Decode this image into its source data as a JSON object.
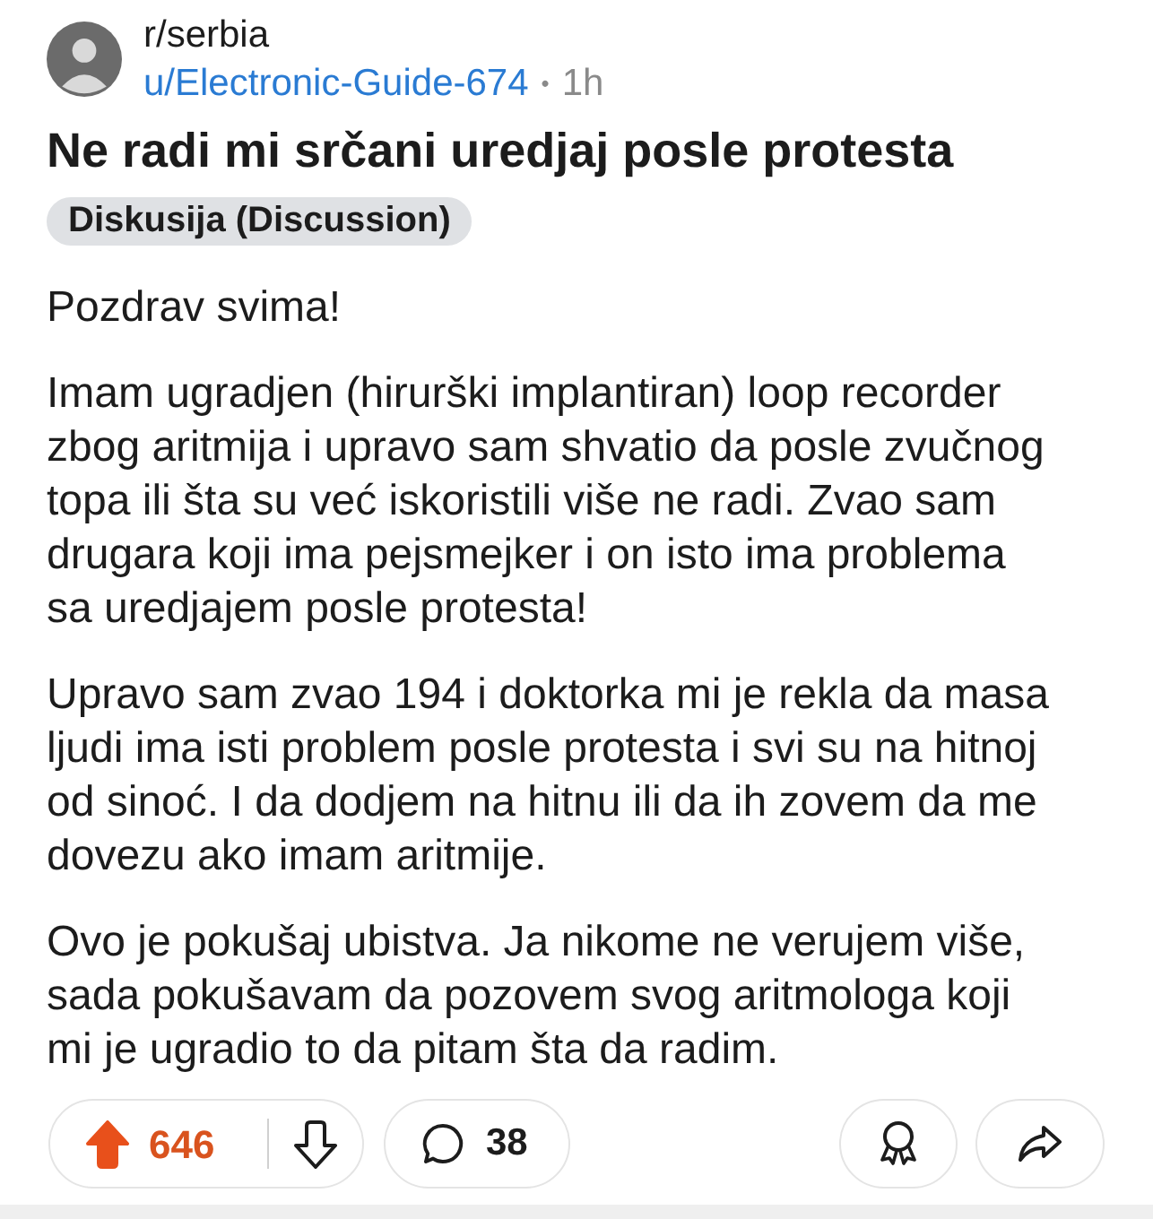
{
  "post": {
    "subreddit": "r/serbia",
    "author": "u/Electronic-Guide-674",
    "separator": "•",
    "age": "1h",
    "title": "Ne radi mi srčani uredjaj posle protesta",
    "flair": "Diskusija (Discussion)",
    "body": [
      "Pozdrav svima!",
      "Imam ugradjen (hirurški implantiran) loop recorder zbog aritmija i upravo sam shvatio da posle zvučnog topa ili šta su već iskoristili više ne radi. Zvao sam drugara koji ima pejsmejker i on isto ima problema sa uredjajem posle protesta!",
      "Upravo sam zvao 194 i doktorka mi je rekla da masa ljudi ima isti problem posle protesta i svi su na hitnoj od sinoć. I da dodjem na hitnu ili da ih zovem da me dovezu ako imam aritmije.",
      "Ovo je pokušaj ubistva. Ja nikome ne verujem više, sada pokušavam da pozovem svog aritmologa koji mi je ugradio to da pitam šta da radim."
    ]
  },
  "actions": {
    "upvoted": true,
    "score": "646",
    "comments": "38"
  }
}
